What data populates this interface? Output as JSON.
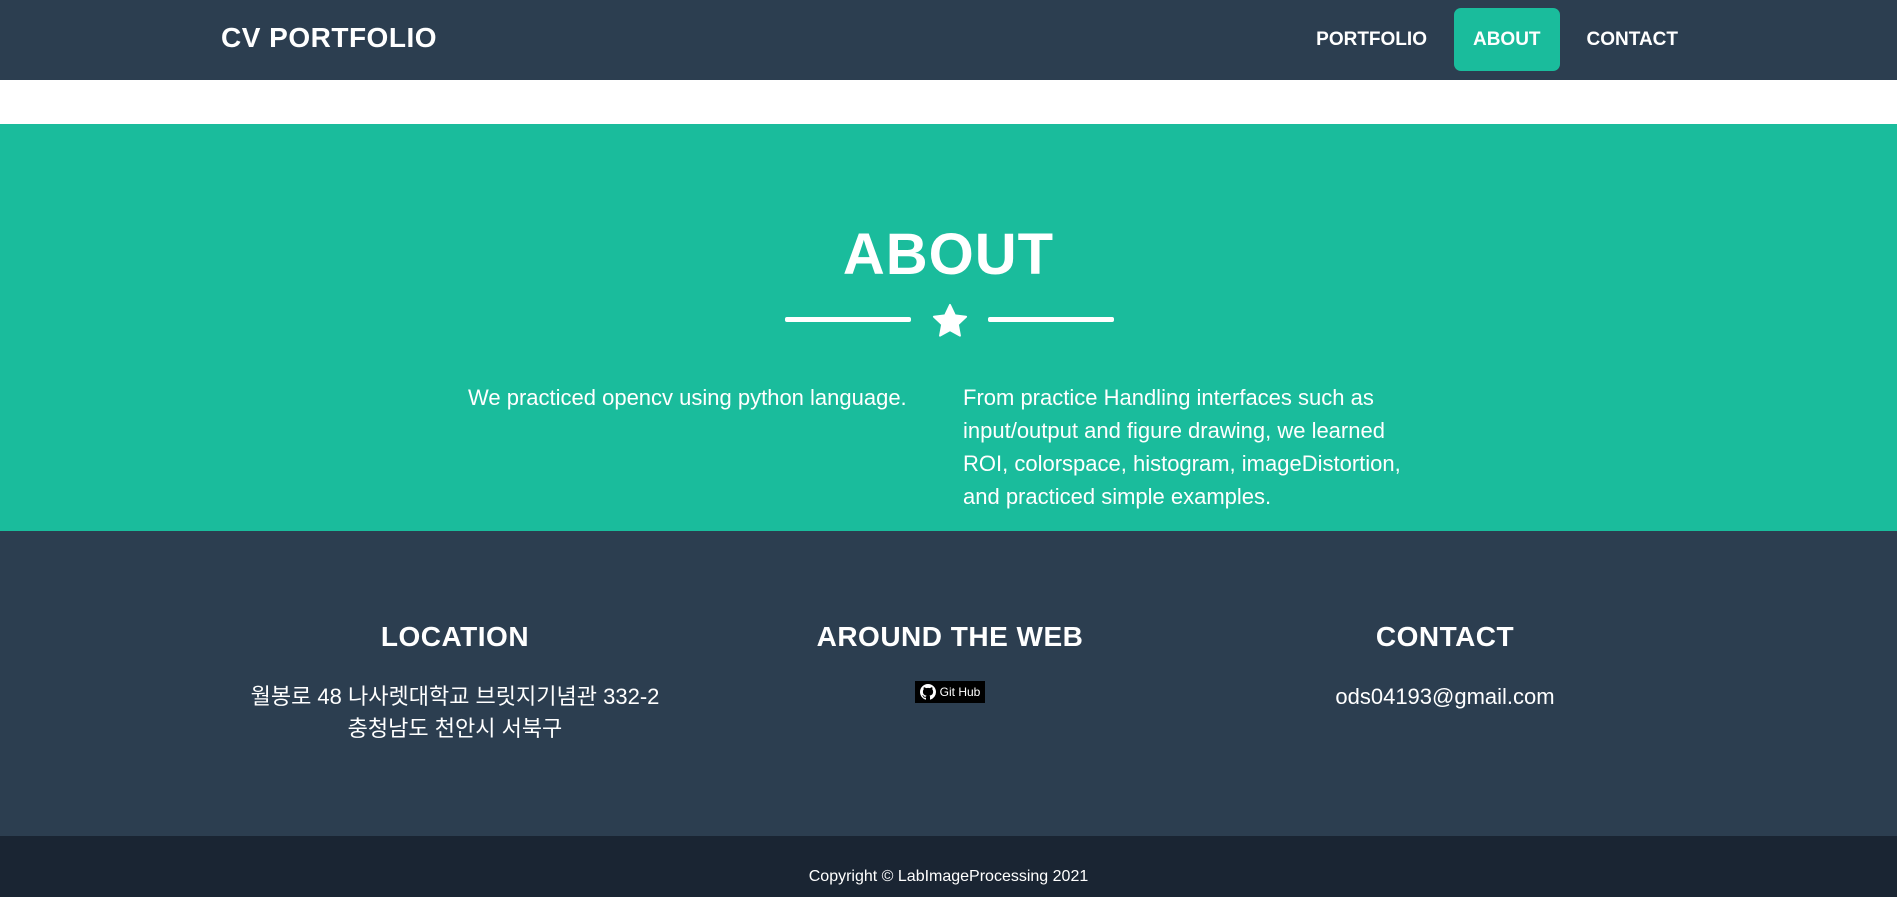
{
  "navbar": {
    "brand": "CV PORTFOLIO",
    "links": [
      {
        "label": "PORTFOLIO",
        "active": false
      },
      {
        "label": "ABOUT",
        "active": true
      },
      {
        "label": "CONTACT",
        "active": false
      }
    ]
  },
  "about": {
    "title": "ABOUT",
    "divider_icon": "star-icon",
    "col_left": "We practiced opencv using python language.",
    "col_right": "From practice Handling interfaces such as input/output and figure drawing, we learned ROI, colorspace, histogram, imageDistortion, and practiced simple examples."
  },
  "footer": {
    "location": {
      "heading": "LOCATION",
      "line1": "월봉로 48 나사렛대학교 브릿지기념관 332-2",
      "line2": "충청남도 천안시 서북구"
    },
    "web": {
      "heading": "AROUND THE WEB",
      "badge_label": "Git Hub",
      "badge_icon": "github-icon"
    },
    "contact": {
      "heading": "CONTACT",
      "email": "ods04193@gmail.com"
    }
  },
  "copyright": "Copyright © LabImageProcessing 2021",
  "colors": {
    "navy": "#2c3e50",
    "teal": "#1abc9c",
    "dark": "#1a2533"
  }
}
